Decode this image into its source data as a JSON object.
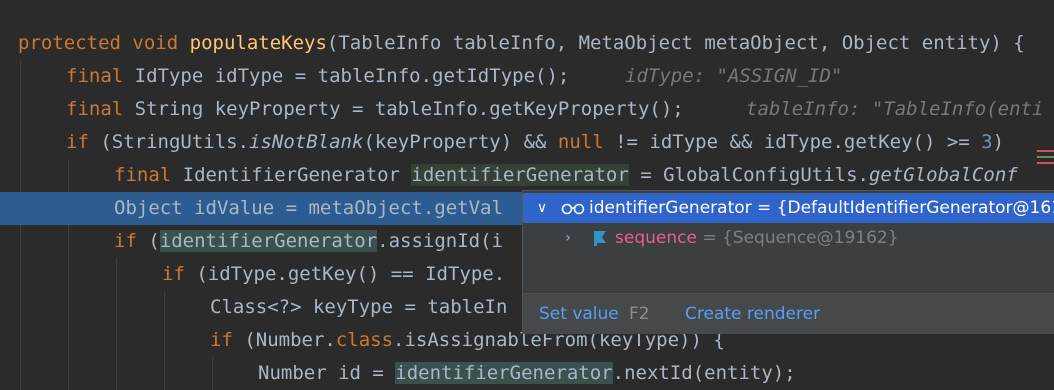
{
  "code": {
    "l1": {
      "mod": "protected",
      "type": "void",
      "name": "populateKeys",
      "open": "(",
      "p1t": "TableInfo",
      "p1": " tableInfo, ",
      "p2t": "MetaObject",
      "p2": " metaObject, ",
      "p3t": "Object",
      "p3": " entity) {"
    },
    "l2": {
      "kw": "final",
      "rest": " IdType idType = tableInfo.getIdType();",
      "hint": "idType: \"ASSIGN_ID\""
    },
    "l3": {
      "kw": "final",
      "rest": " String keyProperty = tableInfo.getKeyProperty();",
      "hint": "tableInfo: \"TableInfo(enti"
    },
    "l4": {
      "kw": "if",
      "a": " (StringUtils.",
      "m": "isNotBlank",
      "b": "(keyProperty) && ",
      "nul": "null",
      "c": " != idType && idType.getKey() >= ",
      "num": "3",
      "d": ")"
    },
    "l5": {
      "kw": "final",
      "a": " IdentifierGenerator ",
      "var": "identifierGenerator",
      "b": " = GlobalConfigUtils.",
      "m": "getGlobalConf"
    },
    "l6": {
      "text": "Object idValue = metaObject.getVal"
    },
    "l7": {
      "kw": "if",
      "a": " (",
      "var": "identifierGenerator",
      "b": ".assignId(i"
    },
    "l8": {
      "kw": "if",
      "a": " (idType.getKey() == IdType."
    },
    "l9": {
      "text": "Class<?> keyType = tableIn"
    },
    "l10": {
      "kw": "if",
      "a": " (Number.",
      "cls": "class",
      "b": ".isAssignableFrom(keyType)) {"
    },
    "l11": {
      "a": "Number id = ",
      "var": "identifierGenerator",
      "b": ".nextId(entity);"
    }
  },
  "debug_popup": {
    "selected": {
      "name": "identifierGenerator",
      "value": " = {DefaultIdentifierGenerator@161"
    },
    "child": {
      "name": "sequence",
      "value": " = {Sequence@19162}"
    },
    "set_value_label": "Set value",
    "set_value_key": "F2",
    "create_renderer_label": "Create renderer"
  },
  "colors": {
    "background": "#2b2b2b",
    "keyword": "#cc7832",
    "method": "#ffc66d",
    "execution_line": "#2d5d90",
    "popup_selection": "#2f65ca",
    "link": "#589df6"
  }
}
